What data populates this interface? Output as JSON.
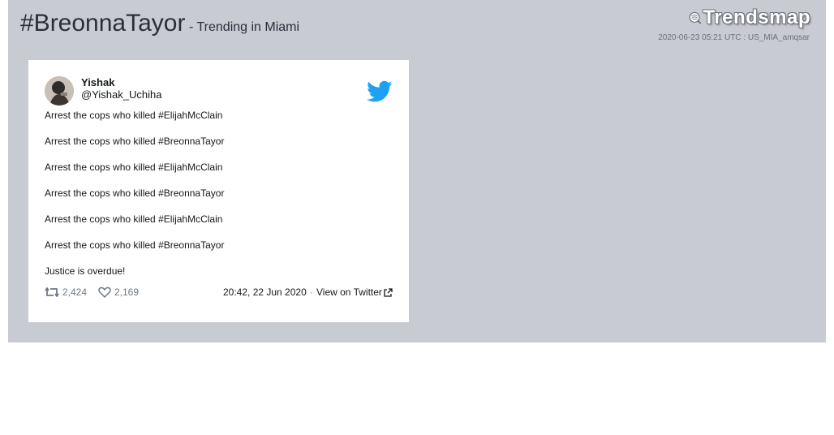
{
  "header": {
    "hashtag": "#BreonnaTayor",
    "trending_label": "- Trending in Miami",
    "brand": "Trendsmap",
    "stamp": "2020-06-23 05:21 UTC : US_MIA_amqsar"
  },
  "tweet": {
    "name": "Yishak",
    "handle": "@Yishak_Uchiha",
    "lines": [
      "Arrest the cops who killed #ElijahMcClain",
      "Arrest the cops who killed #BreonnaTayor",
      "Arrest the cops who killed #ElijahMcClain",
      "Arrest the cops who killed #BreonnaTayor",
      "Arrest the cops who killed #ElijahMcClain",
      "Arrest the cops who killed #BreonnaTayor",
      "Justice is overdue!"
    ],
    "retweets": "2,424",
    "likes": "2,169",
    "timestamp": "20:42, 22 Jun 2020",
    "separator": "·",
    "view_label": "View on Twitter"
  },
  "icons": [
    "trendsmap-logo-icon",
    "twitter-bird-icon",
    "retweet-icon",
    "heart-icon",
    "external-link-icon"
  ],
  "colors": {
    "panel": "#c9cbd3",
    "twitter_blue": "#1da1f2",
    "text_dark": "#14171a",
    "muted": "#6d7785"
  }
}
